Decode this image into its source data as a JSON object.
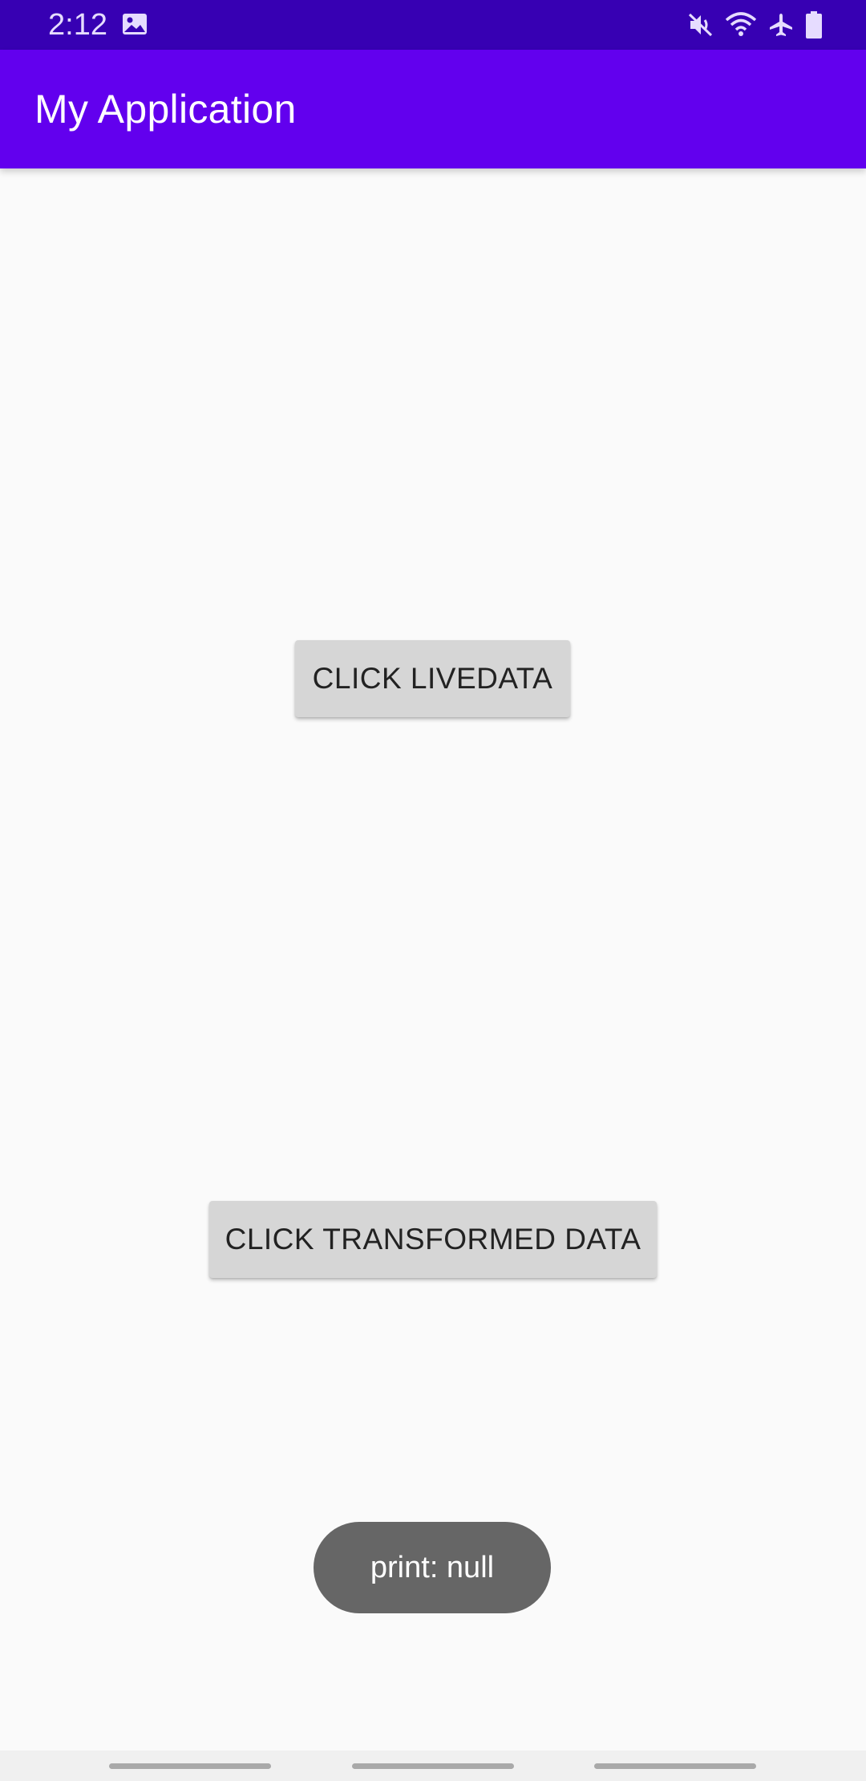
{
  "status_bar": {
    "time": "2:12",
    "icons": [
      "gallery-icon",
      "mute-icon",
      "wifi-icon",
      "airplane-icon",
      "battery-icon"
    ]
  },
  "app_bar": {
    "title": "My Application",
    "color": "#6200ee",
    "status_color": "#3700b3"
  },
  "main": {
    "livedata_button": "CLICK LIVEDATA",
    "transformed_button": "CLICK TRANSFORMED DATA"
  },
  "toast": {
    "text": "print: null"
  },
  "nav_bar": {
    "handles": 3
  }
}
